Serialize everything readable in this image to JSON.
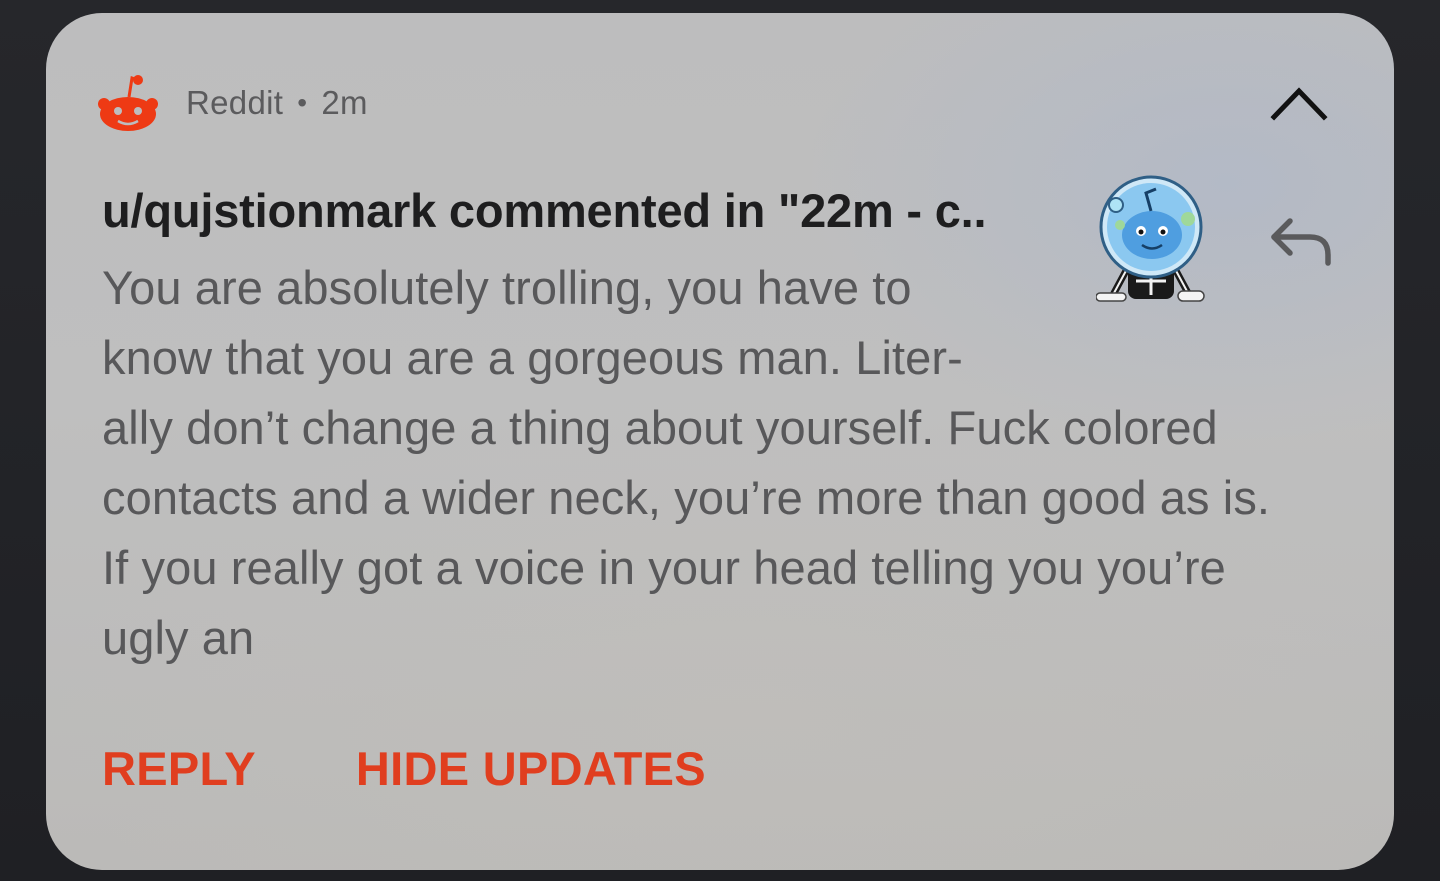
{
  "notification": {
    "app_name": "Reddit",
    "separator": "•",
    "time": "2m",
    "app_icon": "reddit-snoo-icon",
    "title": "u/qujstionmark commented in \"22m - c..",
    "body_lines": [
      "You are absolutely trolling, you have to",
      "know that you are a gorgeous man. Liter-",
      "ally don’t change a thing about yourself. Fuck colored",
      "contacts and a wider neck, you’re more than good as is.",
      "If you really got a voice in your head telling you you’re",
      "ugly an"
    ],
    "actions": {
      "reply": "REPLY",
      "hide_updates": "HIDE UPDATES"
    },
    "colors": {
      "accent": "#e03e1f",
      "title": "#1e1e1f",
      "body": "#58585a",
      "meta": "#5b5b5d"
    }
  }
}
